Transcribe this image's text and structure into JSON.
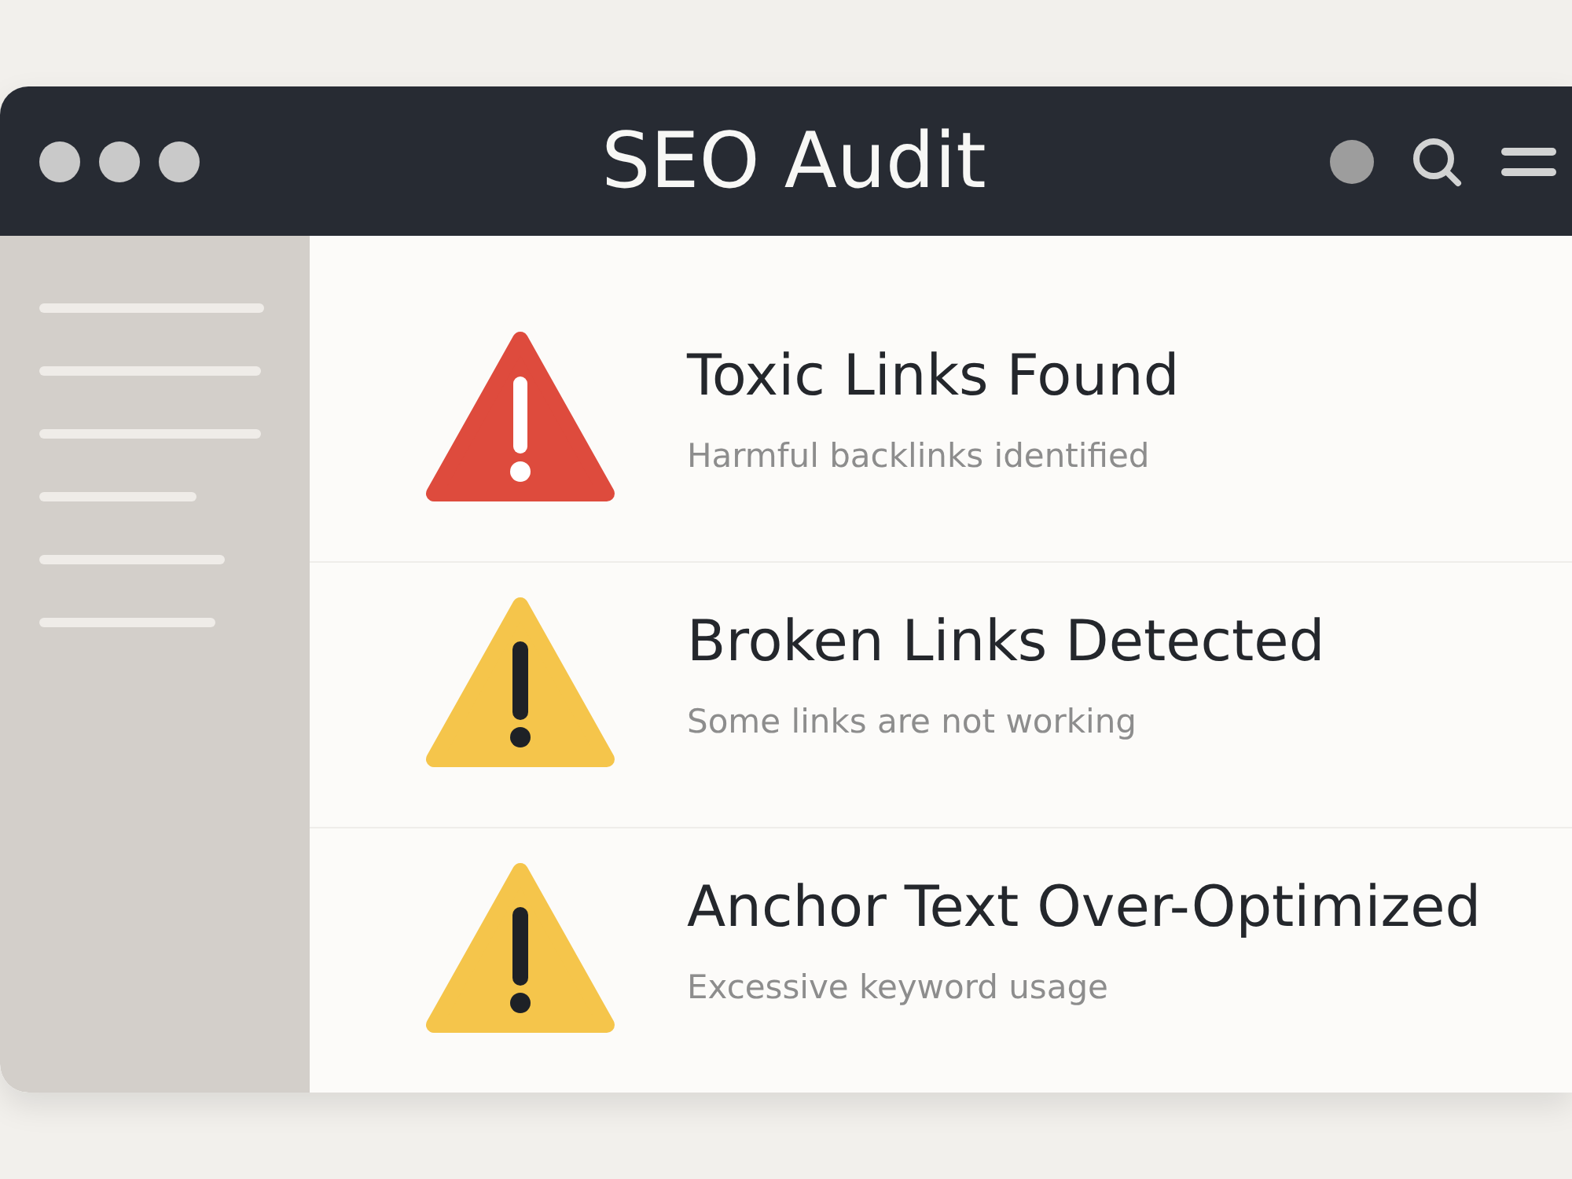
{
  "window": {
    "title": "SEO Audit"
  },
  "alerts": [
    {
      "kind": "error",
      "title": "Toxic Links Found",
      "description": "Harmful backlinks identified"
    },
    {
      "kind": "warning",
      "title": "Broken Links Detected",
      "description": "Some links are not working"
    },
    {
      "kind": "warning",
      "title": "Anchor Text Over-Optimized",
      "description": "Excessive keyword usage"
    }
  ]
}
